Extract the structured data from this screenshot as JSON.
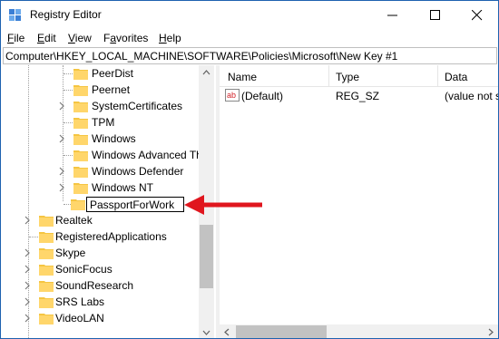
{
  "window": {
    "title": "Registry Editor"
  },
  "menu": [
    {
      "label": "File",
      "underline": "F",
      "rest": "ile"
    },
    {
      "label": "Edit",
      "underline": "E",
      "rest": "dit"
    },
    {
      "label": "View",
      "underline": "V",
      "rest": "iew"
    },
    {
      "label": "Favorites",
      "underline": "a",
      "pre": "F",
      "rest": "vorites"
    },
    {
      "label": "Help",
      "underline": "H",
      "rest": "elp"
    }
  ],
  "address": {
    "path": "Computer\\HKEY_LOCAL_MACHINE\\SOFTWARE\\Policies\\Microsoft\\New Key #1"
  },
  "tree": {
    "children_of_microsoft": [
      {
        "label": "PeerDist",
        "expandable": false
      },
      {
        "label": "Peernet",
        "expandable": false
      },
      {
        "label": "SystemCertificates",
        "expandable": true
      },
      {
        "label": "TPM",
        "expandable": false
      },
      {
        "label": "Windows",
        "expandable": true
      },
      {
        "label": "Windows Advanced Th",
        "expandable": false
      },
      {
        "label": "Windows Defender",
        "expandable": true
      },
      {
        "label": "Windows NT",
        "expandable": true
      }
    ],
    "renaming": {
      "value": "PassportForWork"
    },
    "software_keys": [
      {
        "label": "Realtek",
        "expandable": true
      },
      {
        "label": "RegisteredApplications",
        "expandable": false
      },
      {
        "label": "Skype",
        "expandable": true
      },
      {
        "label": "SonicFocus",
        "expandable": true
      },
      {
        "label": "SoundResearch",
        "expandable": true
      },
      {
        "label": "SRS Labs",
        "expandable": true
      },
      {
        "label": "VideoLAN",
        "expandable": true
      }
    ]
  },
  "list": {
    "columns": {
      "name": "Name",
      "type": "Type",
      "data": "Data"
    },
    "rows": [
      {
        "name": "(Default)",
        "type": "REG_SZ",
        "data": "(value not set)"
      }
    ]
  },
  "colors": {
    "folder": "#f5c542",
    "accent_red": "#e0161e",
    "border": "#1e62b0"
  }
}
